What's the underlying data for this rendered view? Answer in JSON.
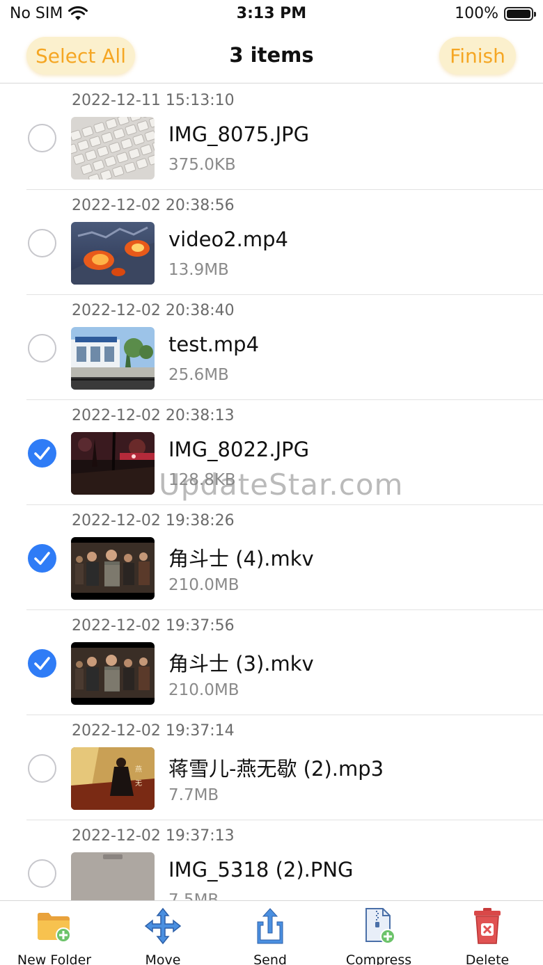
{
  "status": {
    "carrier": "No SIM",
    "time": "3:13 PM",
    "battery": "100%",
    "battery_level": 1.0
  },
  "nav": {
    "select_all_label": "Select All",
    "title": "3 items",
    "finish_label": "Finish"
  },
  "files": [
    {
      "date": "2022-12-11 15:13:10",
      "name": "IMG_8075.JPG",
      "size": "375.0KB",
      "selected": false,
      "thumb": "keyboard-photo"
    },
    {
      "date": "2022-12-02 20:38:56",
      "name": "video2.mp4",
      "size": "13.9MB",
      "selected": false,
      "thumb": "fire-video"
    },
    {
      "date": "2022-12-02 20:38:40",
      "name": "test.mp4",
      "size": "25.6MB",
      "selected": false,
      "thumb": "street-video"
    },
    {
      "date": "2022-12-02 20:38:13",
      "name": "IMG_8022.JPG",
      "size": "128.8KB",
      "selected": true,
      "thumb": "night-photo"
    },
    {
      "date": "2022-12-02 19:38:26",
      "name": "角斗士 (4).mkv",
      "size": "210.0MB",
      "selected": true,
      "thumb": "movie-still"
    },
    {
      "date": "2022-12-02 19:37:56",
      "name": "角斗士 (3).mkv",
      "size": "210.0MB",
      "selected": true,
      "thumb": "movie-still"
    },
    {
      "date": "2022-12-02 19:37:14",
      "name": "蒋雪儿-燕无歇 (2).mp3",
      "size": "7.7MB",
      "selected": false,
      "thumb": "album-cover"
    },
    {
      "date": "2022-12-02 19:37:13",
      "name": "IMG_5318 (2).PNG",
      "size": "7.5MB",
      "selected": false,
      "thumb": "gray-screenshot"
    }
  ],
  "watermark": "UpdateStar.com",
  "toolbar": {
    "new_folder": "New Folder",
    "move": "Move",
    "send": "Send",
    "compress": "Compress",
    "delete": "Delete"
  },
  "colors": {
    "accent": "#f5a623",
    "pill_bg": "#fbf0cd",
    "check_on": "#2f7cf6"
  }
}
